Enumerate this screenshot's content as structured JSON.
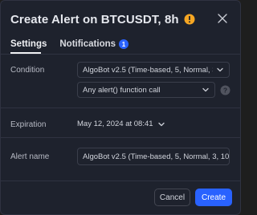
{
  "dialog": {
    "title": "Create Alert on BTCUSDT, 8h",
    "warning_icon": "warning-icon",
    "warning_color": "#f5a623",
    "close_icon": "close-icon"
  },
  "tabs": [
    {
      "label": "Settings",
      "active": true
    },
    {
      "label": "Notifications",
      "badge": "1",
      "active": false
    }
  ],
  "condition": {
    "label": "Condition",
    "indicator_select": "AlgoBot v2.5 (Time-based, 5, Normal, 3, ...",
    "function_select": "Any alert() function call"
  },
  "expiration": {
    "label": "Expiration",
    "value": "May 12, 2024 at 08:41"
  },
  "alert_name": {
    "label": "Alert name",
    "value": "AlgoBot v2.5 (Time-based, 5, Normal, 3, 10, %,"
  },
  "buttons": {
    "cancel": "Cancel",
    "create": "Create"
  },
  "colors": {
    "accent": "#2962ff",
    "background": "#1e222d",
    "text": "#d1d4dc"
  }
}
